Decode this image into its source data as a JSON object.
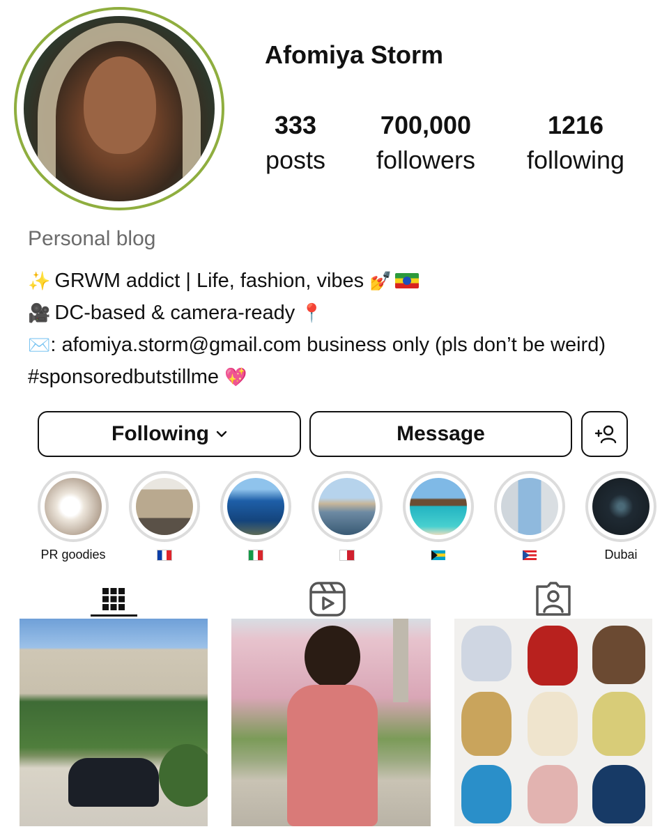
{
  "profile": {
    "username": "Afomiya Storm",
    "category": "Personal blog",
    "avatar_ring_color": "#8fae3f"
  },
  "stats": [
    {
      "value": "333",
      "label": "posts"
    },
    {
      "value": "700,000",
      "label": "followers"
    },
    {
      "value": "1216",
      "label": "following"
    }
  ],
  "bio": {
    "line1": "GRWM addict | Life, fashion, vibes",
    "line2": "DC-based & camera-ready",
    "line3": ": afomiya.storm@gmail.com business only (pls don’t be weird)",
    "line4": "#sponsoredbutstillme",
    "icons": [
      "sparkles-icon",
      "nail-polish-icon",
      "ethiopia-flag-icon",
      "movie-camera-icon",
      "pin-icon",
      "envelope-icon",
      "heart-icon"
    ]
  },
  "actions": {
    "following_label": "Following",
    "message_label": "Message"
  },
  "highlights": [
    {
      "caption": "PR goodies"
    },
    {
      "caption": "",
      "flag": "france"
    },
    {
      "caption": "",
      "flag": "italy"
    },
    {
      "caption": "",
      "flag": "malta"
    },
    {
      "caption": "",
      "flag": "bahamas"
    },
    {
      "caption": "",
      "flag": "puerto-rico"
    },
    {
      "caption": "Dubai"
    }
  ],
  "tabs": [
    {
      "name": "posts-grid",
      "icon": "grid-icon",
      "active": true
    },
    {
      "name": "reels",
      "icon": "reels-icon",
      "active": false
    },
    {
      "name": "tagged",
      "icon": "tagged-user-icon",
      "active": false
    }
  ]
}
